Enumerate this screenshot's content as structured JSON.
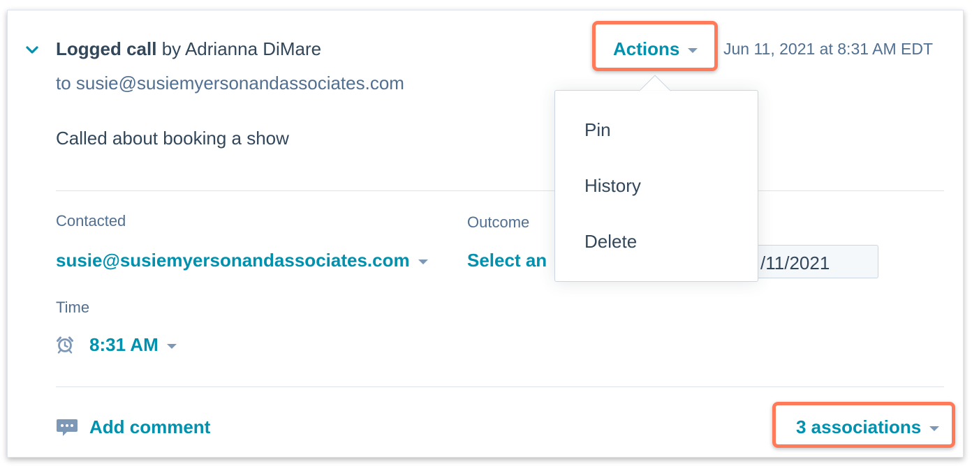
{
  "activity": {
    "type_label": "Logged call",
    "by_prefix": "by",
    "author": "Adrianna DiMare",
    "to_line": "to susie@susiemyersonandassociates.com",
    "note": "Called about booking a show",
    "timestamp": "Jun 11, 2021 at 8:31 AM EDT",
    "actions_label": "Actions"
  },
  "actions_menu": {
    "items": [
      {
        "label": "Pin"
      },
      {
        "label": "History"
      },
      {
        "label": "Delete"
      }
    ]
  },
  "fields": {
    "contacted_label": "Contacted",
    "contacted_value": "susie@susiemyersonandassociates.com",
    "outcome_label": "Outcome",
    "outcome_value": "Select an",
    "date_value": "/11/2021",
    "time_label": "Time",
    "time_value": "8:31 AM"
  },
  "footer": {
    "add_comment_label": "Add comment",
    "associations_label": "3 associations"
  },
  "colors": {
    "link": "#0091ae",
    "text": "#33475b",
    "muted": "#516f90",
    "highlight": "#ff7a59"
  }
}
